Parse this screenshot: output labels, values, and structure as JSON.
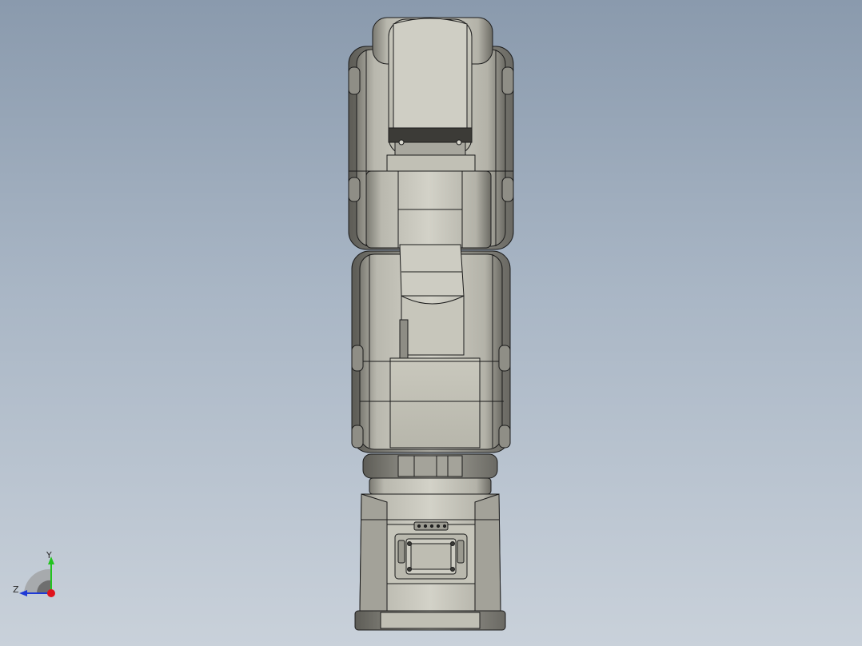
{
  "viewport": {
    "background_top": "#8a9aad",
    "background_bottom": "#c9d1da",
    "model": "robot-arm",
    "view": "front-view"
  },
  "triad": {
    "y_label": "Y",
    "z_label": "Z",
    "y_color": "#22c41f",
    "z_color": "#1f3ad6",
    "x_color": "#e0131c"
  },
  "colors": {
    "body_fill": "#c4c3b8",
    "body_dark": "#6e6e66",
    "edge": "#1b1b1b"
  }
}
